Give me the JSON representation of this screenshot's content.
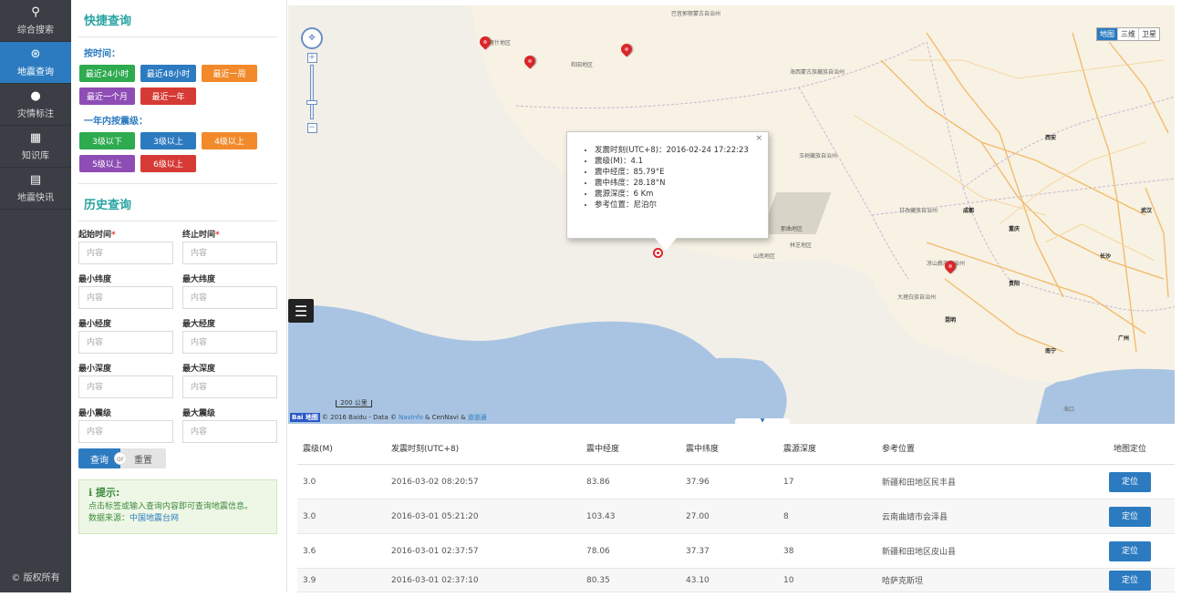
{
  "nav": {
    "items": [
      {
        "icon": "search-icon",
        "glyph": "🔍",
        "label": "综合搜索"
      },
      {
        "icon": "earthquake-icon",
        "glyph": "⊛",
        "label": "地震查询"
      },
      {
        "icon": "map-pin-icon",
        "glyph": "⬤",
        "label": "灾情标注"
      },
      {
        "icon": "book-icon",
        "glyph": "▆",
        "label": "知识库"
      },
      {
        "icon": "news-icon",
        "glyph": "▤",
        "label": "地震快讯"
      }
    ],
    "copyright": "© 版权所有"
  },
  "quick": {
    "title": "快捷查询",
    "by_time_label": "按时间：",
    "time_buttons": [
      "最近24小时",
      "最近48小时",
      "最近一周",
      "最近一个月",
      "最近一年"
    ],
    "by_mag_label": "一年内按震级：",
    "mag_buttons": [
      "3级以下",
      "3级以上",
      "4级以上",
      "5级以上",
      "6级以上"
    ]
  },
  "history": {
    "title": "历史查询",
    "fields": [
      {
        "label": "起始时间",
        "required": true,
        "placeholder": "内容"
      },
      {
        "label": "终止时间",
        "required": true,
        "placeholder": "内容"
      },
      {
        "label": "最小纬度",
        "required": false,
        "placeholder": "内容"
      },
      {
        "label": "最大纬度",
        "required": false,
        "placeholder": "内容"
      },
      {
        "label": "最小经度",
        "required": false,
        "placeholder": "内容"
      },
      {
        "label": "最大经度",
        "required": false,
        "placeholder": "内容"
      },
      {
        "label": "最小深度",
        "required": false,
        "placeholder": "内容"
      },
      {
        "label": "最大深度",
        "required": false,
        "placeholder": "内容"
      },
      {
        "label": "最小震级",
        "required": false,
        "placeholder": "内容"
      },
      {
        "label": "最大震级",
        "required": false,
        "placeholder": "内容"
      }
    ],
    "query_label": "查询",
    "or_label": "or",
    "reset_label": "重置"
  },
  "hint": {
    "title": "提示:",
    "text": "点击标签或输入查询内容即可查询地震信息。",
    "source_prefix": "数据来源：",
    "source_link": "中国地震台网"
  },
  "map": {
    "type_options": [
      "地图",
      "三维",
      "卫星"
    ],
    "scale_label": "200 公里",
    "footer_logo": "Bai 地图",
    "footer_text": "© 2016 Baidu - Data ©",
    "footer_link1": "NavInfo",
    "footer_mid": "& CenNavi &",
    "footer_link2": "道道通",
    "labels": [
      "巴音郭楞蒙古自治州",
      "喀什地区",
      "和田地区",
      "海西蒙古族藏族自治州",
      "玉树藏族自治州",
      "山南地区",
      "林芝地区",
      "那曲地区",
      "甘孜藏族自治州",
      "凉山彝族自治州",
      "大理白族自治州",
      "重庆",
      "西安",
      "武汉",
      "南宁",
      "海口",
      "成都",
      "昆明",
      "贵阳",
      "长沙",
      "广州"
    ],
    "popup": {
      "items": [
        "发震时刻(UTC+8)：2016-02-24 17:22:23",
        "震级(M)：4.1",
        "震中经度：85.79°E",
        "震中纬度：28.18°N",
        "震源深度：6 Km",
        "参考位置：尼泊尔"
      ],
      "close": "×"
    }
  },
  "table": {
    "headers": [
      "震级(M)",
      "发震时刻(UTC+8)",
      "震中经度",
      "震中纬度",
      "震源深度",
      "参考位置",
      "地图定位"
    ],
    "rows": [
      {
        "mag": "3.0",
        "time": "2016-03-02 08:20:57",
        "lon": "83.86",
        "lat": "37.96",
        "depth": "17",
        "place": "新疆和田地区民丰县",
        "btn": "定位"
      },
      {
        "mag": "3.0",
        "time": "2016-03-01 05:21:20",
        "lon": "103.43",
        "lat": "27.00",
        "depth": "8",
        "place": "云南曲靖市会泽县",
        "btn": "定位"
      },
      {
        "mag": "3.6",
        "time": "2016-03-01 02:37:57",
        "lon": "78.06",
        "lat": "37.37",
        "depth": "38",
        "place": "新疆和田地区皮山县",
        "btn": "定位"
      },
      {
        "mag": "3.9",
        "time": "2016-03-01 02:37:10",
        "lon": "80.35",
        "lat": "43.10",
        "depth": "10",
        "place": "哈萨克斯坦",
        "btn": "定位"
      }
    ]
  },
  "colors": {
    "accent": "#2c7bc0",
    "teal": "#2aa3a3",
    "nav_bg": "#3b3f45",
    "marker": "#d9272a"
  }
}
